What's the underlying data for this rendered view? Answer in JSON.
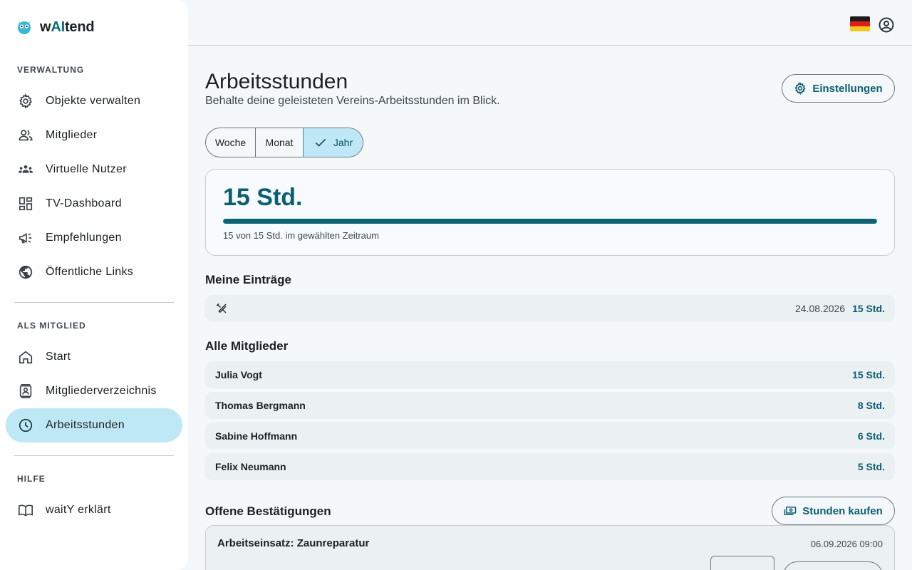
{
  "brand": {
    "prefix": "w",
    "ai": "AI",
    "suffix": "tend"
  },
  "sidebar": {
    "sections": {
      "admin": "VERWALTUNG",
      "member": "ALS MITGLIED",
      "help": "HILFE"
    },
    "items": [
      {
        "label": "Objekte verwalten",
        "icon": "gear-icon"
      },
      {
        "label": "Mitglieder",
        "icon": "members-icon"
      },
      {
        "label": "Virtuelle Nutzer",
        "icon": "group-icon"
      },
      {
        "label": "TV-Dashboard",
        "icon": "dashboard-icon"
      },
      {
        "label": "Empfehlungen",
        "icon": "campaign-icon"
      },
      {
        "label": "Öffentliche Links",
        "icon": "globe-icon"
      },
      {
        "label": "Start",
        "icon": "home-icon"
      },
      {
        "label": "Mitgliederverzeichnis",
        "icon": "contact-book-icon"
      },
      {
        "label": "Arbeitsstunden",
        "icon": "clock-icon",
        "active": true
      },
      {
        "label": "waitY erklärt",
        "icon": "book-icon"
      }
    ]
  },
  "topbar": {
    "flag": "germany-flag-icon",
    "user": "account-icon"
  },
  "page": {
    "title": "Arbeitsstunden",
    "subtitle": "Behalte deine geleisteten Vereins-Arbeitsstunden im Blick.",
    "settings_label": "Einstellungen"
  },
  "period": {
    "options": [
      "Woche",
      "Monat",
      "Jahr"
    ],
    "selected": "Jahr"
  },
  "summary": {
    "total": "15 Std.",
    "progress": 1.0,
    "caption": "15 von 15 Std. im gewählten Zeitraum"
  },
  "my_entries": {
    "heading": "Meine Einträge",
    "items": [
      {
        "icon": "tools-icon",
        "date": "24.08.2026",
        "hours": "15 Std."
      }
    ]
  },
  "all_members": {
    "heading": "Alle Mitglieder",
    "items": [
      {
        "name": "Julia Vogt",
        "hours": "15 Std."
      },
      {
        "name": "Thomas Bergmann",
        "hours": "8 Std."
      },
      {
        "name": "Sabine Hoffmann",
        "hours": "6 Std."
      },
      {
        "name": "Felix Neumann",
        "hours": "5 Std."
      }
    ]
  },
  "pending": {
    "heading": "Offene Bestätigungen",
    "buy_label": "Stunden kaufen",
    "items": [
      {
        "title": "Arbeitseinsatz: Zaunreparatur",
        "datetime": "06.09.2026 09:00"
      }
    ]
  },
  "colors": {
    "accent": "#0b5f70",
    "active_bg": "#bfe8f6",
    "background": "#f4f8fb"
  }
}
